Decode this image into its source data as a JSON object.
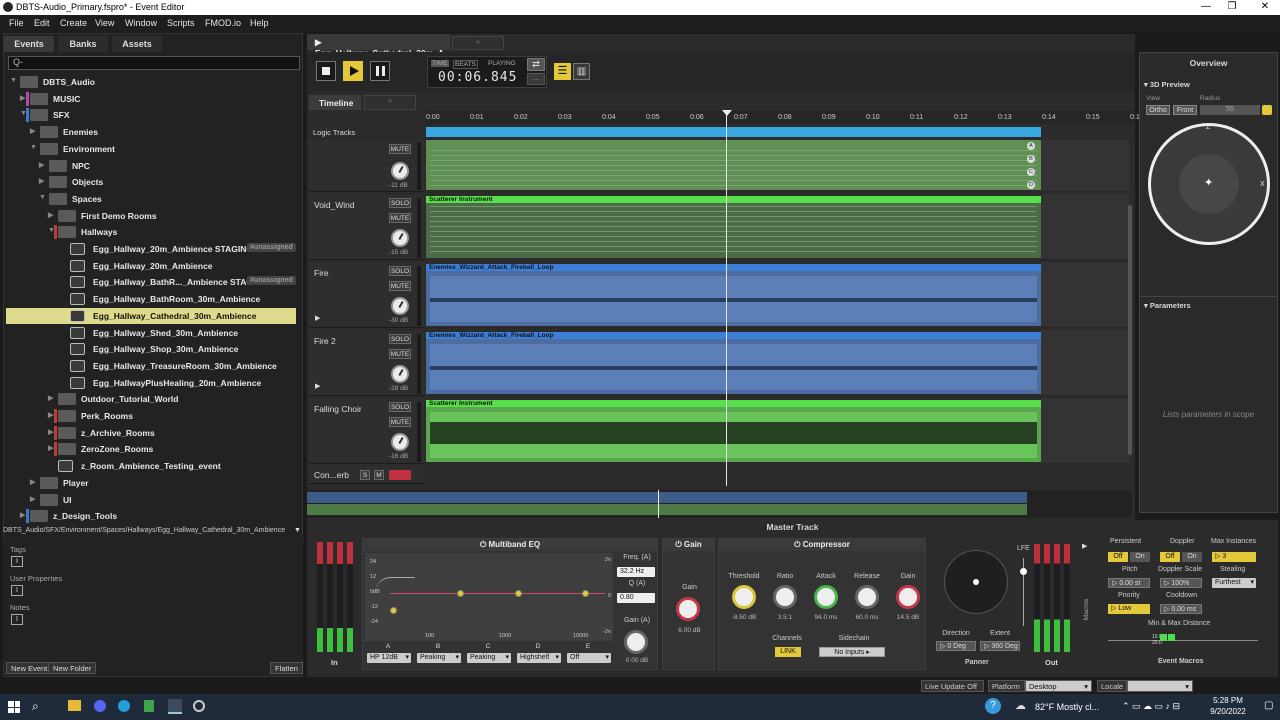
{
  "window": {
    "title": "DBTS-Audio_Primary.fspro* - Event Editor",
    "controls": [
      "—",
      "❐",
      "✕"
    ]
  },
  "menu": [
    "File",
    "Edit",
    "Create",
    "View",
    "Window",
    "Scripts",
    "FMOD.io",
    "Help"
  ],
  "browser": {
    "tabs": [
      "Events",
      "Banks",
      "Assets"
    ],
    "search_placeholder": "Q-",
    "tree": [
      {
        "label": "DBTS_Audio",
        "depth": 0,
        "kind": "folder",
        "open": true
      },
      {
        "label": "MUSIC",
        "depth": 1,
        "kind": "folder",
        "color": "#b04bb0"
      },
      {
        "label": "SFX",
        "depth": 1,
        "kind": "folder",
        "open": true,
        "color": "#3c7bd0"
      },
      {
        "label": "Enemies",
        "depth": 2,
        "kind": "folder"
      },
      {
        "label": "Environment",
        "depth": 2,
        "kind": "folder",
        "open": true
      },
      {
        "label": "NPC",
        "depth": 3,
        "kind": "folder"
      },
      {
        "label": "Objects",
        "depth": 3,
        "kind": "folder"
      },
      {
        "label": "Spaces",
        "depth": 3,
        "kind": "folder",
        "open": true
      },
      {
        "label": "First Demo Rooms",
        "depth": 4,
        "kind": "folder"
      },
      {
        "label": "Hallways",
        "depth": 4,
        "kind": "folder",
        "open": true,
        "color": "#c43a3a"
      },
      {
        "label": "Egg_Hallway_20m_Ambience STAGING",
        "depth": 5,
        "kind": "event",
        "tag": "#unassigned"
      },
      {
        "label": "Egg_Hallway_20m_Ambience",
        "depth": 5,
        "kind": "event"
      },
      {
        "label": "Egg_Hallway_BathR..._Ambience STAGING",
        "depth": 5,
        "kind": "event",
        "tag": "#unassigned"
      },
      {
        "label": "Egg_Hallway_BathRoom_30m_Ambience",
        "depth": 5,
        "kind": "event"
      },
      {
        "label": "Egg_Hallway_Cathedral_30m_Ambience",
        "depth": 5,
        "kind": "event",
        "selected": true
      },
      {
        "label": "Egg_Hallway_Shed_30m_Ambience",
        "depth": 5,
        "kind": "event"
      },
      {
        "label": "Egg_Hallway_Shop_30m_Ambience",
        "depth": 5,
        "kind": "event"
      },
      {
        "label": "Egg_Hallway_TreasureRoom_30m_Ambience",
        "depth": 5,
        "kind": "event"
      },
      {
        "label": "Egg_HallwayPlusHealing_20m_Ambience",
        "depth": 5,
        "kind": "event"
      },
      {
        "label": "Outdoor_Tutorial_World",
        "depth": 4,
        "kind": "folder"
      },
      {
        "label": "Perk_Rooms",
        "depth": 4,
        "kind": "folder",
        "color": "#c43a3a"
      },
      {
        "label": "z_Archive_Rooms",
        "depth": 4,
        "kind": "folder",
        "color": "#c43a3a"
      },
      {
        "label": "ZeroZone_Rooms",
        "depth": 4,
        "kind": "folder",
        "color": "#c43a3a"
      },
      {
        "label": "z_Room_Ambience_Testing_event",
        "depth": 4,
        "kind": "event-noarrow"
      },
      {
        "label": "Player",
        "depth": 2,
        "kind": "folder"
      },
      {
        "label": "UI",
        "depth": 2,
        "kind": "folder"
      },
      {
        "label": "z_Design_Tools",
        "depth": 1,
        "kind": "folder",
        "color": "#3c7bd0"
      }
    ],
    "path": "DBTS_Audio/SFX/Environment/Spaces/Hallways/Egg_Hallway_Cathedral_30m_Ambience",
    "sections": [
      "Tags",
      "User Properties",
      "Notes"
    ],
    "buttons": {
      "new_event": "New Event",
      "new_folder": "New Folder",
      "flatten": "Flatten"
    }
  },
  "editor": {
    "event_tab": "Egg_Hallway_Cathedral_30m_A...",
    "timeline_tab": "Timeline",
    "time": {
      "labels": [
        "TIME",
        "BEATS",
        "PLAYING"
      ],
      "display": "00:06.845"
    },
    "ruler": [
      "0:00",
      "0:01",
      "0:02",
      "0:03",
      "0:04",
      "0:05",
      "0:06",
      "0:07",
      "0:08",
      "0:09",
      "0:10",
      "0:11",
      "0:12",
      "0:13",
      "0:14",
      "0:15",
      "0:16"
    ],
    "logic_tracks": "Logic Tracks",
    "tracks": [
      {
        "name": "",
        "db": "-11 dB",
        "buttons": [
          "MUTE"
        ],
        "lane_title": "",
        "lane_color": "#5f8f54",
        "letters": [
          "A",
          "B",
          "C",
          "D"
        ]
      },
      {
        "name": "Void_Wind",
        "db": "-15 dB",
        "buttons": [
          "SOLO",
          "MUTE"
        ],
        "lane_title": "Scatterer Instrument",
        "lane_color": "#4c6b47",
        "hdr_color": "#57e04a"
      },
      {
        "name": "Fire",
        "db": "-30 dB",
        "buttons": [
          "SOLO",
          "MUTE"
        ],
        "lane_title": "Enemies_Wizzard_Attack_Fireball_Loop",
        "lane_color": "#4d6da0",
        "hdr_color": "#3d7fd8"
      },
      {
        "name": "Fire 2",
        "db": "-28 dB",
        "buttons": [
          "SOLO",
          "MUTE"
        ],
        "lane_title": "Enemies_Wizzard_Attack_Fireball_Loop",
        "lane_color": "#4d6da0",
        "hdr_color": "#3d7fd8"
      },
      {
        "name": "Falling Choir",
        "db": "-16 dB",
        "buttons": [
          "SOLO",
          "MUTE"
        ],
        "lane_title": "Scatterer Instrument",
        "lane_color": "#5aa84e",
        "hdr_color": "#57e04a"
      }
    ],
    "return_track": {
      "name": "Con...erb",
      "buttons": [
        "S",
        "M"
      ]
    }
  },
  "overview": {
    "title": "Overview",
    "preview": "3D Preview",
    "view_label": "View",
    "view_buttons": [
      "Ortho",
      "Front"
    ],
    "radius_label": "Radius",
    "radius_value": "55",
    "compass_top": "Z",
    "compass_right": "X",
    "parameters": "Parameters",
    "parameters_empty": "Lists parameters in scope"
  },
  "master": {
    "title": "Master Track",
    "in_label": "In",
    "eq": {
      "title": "Multiband EQ",
      "freq_label": "Freq. (A)",
      "freq_value": "32.2 Hz",
      "q_label": "Q (A)",
      "q_value": "0.80",
      "gain_label": "Gain (A)",
      "gain_value": "0.00 dB",
      "yaxis": [
        "24",
        "12",
        "0dB",
        "-12",
        "-24"
      ],
      "raxis": [
        "2n",
        "",
        "0",
        "",
        "-2n"
      ],
      "xaxis": [
        "100",
        "1000",
        "10000"
      ],
      "bands": [
        {
          "letter": "A",
          "mode": "HP 12dB"
        },
        {
          "letter": "B",
          "mode": "Peaking"
        },
        {
          "letter": "C",
          "mode": "Peaking"
        },
        {
          "letter": "D",
          "mode": "Highshelf"
        },
        {
          "letter": "E",
          "mode": "Off"
        }
      ]
    },
    "gain": {
      "title": "Gain",
      "label": "Gain",
      "value": "6.00 dB"
    },
    "compressor": {
      "title": "Compressor",
      "params": [
        {
          "label": "Threshold",
          "value": "-8.50 dB"
        },
        {
          "label": "Ratio",
          "value": "3.5:1"
        },
        {
          "label": "Attack",
          "value": "94.0 ms"
        },
        {
          "label": "Release",
          "value": "60.0 ms"
        },
        {
          "label": "Gain",
          "value": "14.5 dB"
        }
      ],
      "channels_label": "Channels",
      "link": "LINK",
      "sidechain_label": "Sidechain",
      "sidechain_value": "No Inputs"
    },
    "panner": {
      "label": "Panner",
      "lfe": "LFE",
      "direction_label": "Direction",
      "direction_value": "0 Deg",
      "extent_label": "Extent",
      "extent_value": "360 Deg"
    },
    "out_label": "Out",
    "macros_side": "Macros",
    "macros": {
      "persistent": "Persistent",
      "doppler": "Doppler",
      "max_instances": "Max Instances",
      "off": "Off",
      "on": "On",
      "max_instances_value": "3",
      "pitch": "Pitch",
      "pitch_value": "0.00 st",
      "doppler_scale": "Doppler Scale",
      "doppler_scale_value": "100%",
      "stealing": "Stealing",
      "stealing_value": "Furthest",
      "priority": "Priority",
      "priority_value": "Low",
      "cooldown": "Cooldown",
      "cooldown_value": "0.00 ms",
      "min_max": "Min & Max Distance",
      "range_value": "15.0 - 20.0",
      "title": "Event Macros"
    }
  },
  "statusbar": {
    "live_update": "Live Update Off",
    "platform_label": "Platform",
    "platform_value": "Desktop",
    "locale_label": "Locale"
  },
  "taskbar": {
    "weather": "82°F  Mostly cl...",
    "time": "5:28 PM",
    "date": "9/20/2022"
  },
  "colors": {
    "accent_yellow": "#e3c93a",
    "selected_row": "#dedc8c",
    "green_track": "#57e04a",
    "blue_track": "#3d7fd8"
  }
}
